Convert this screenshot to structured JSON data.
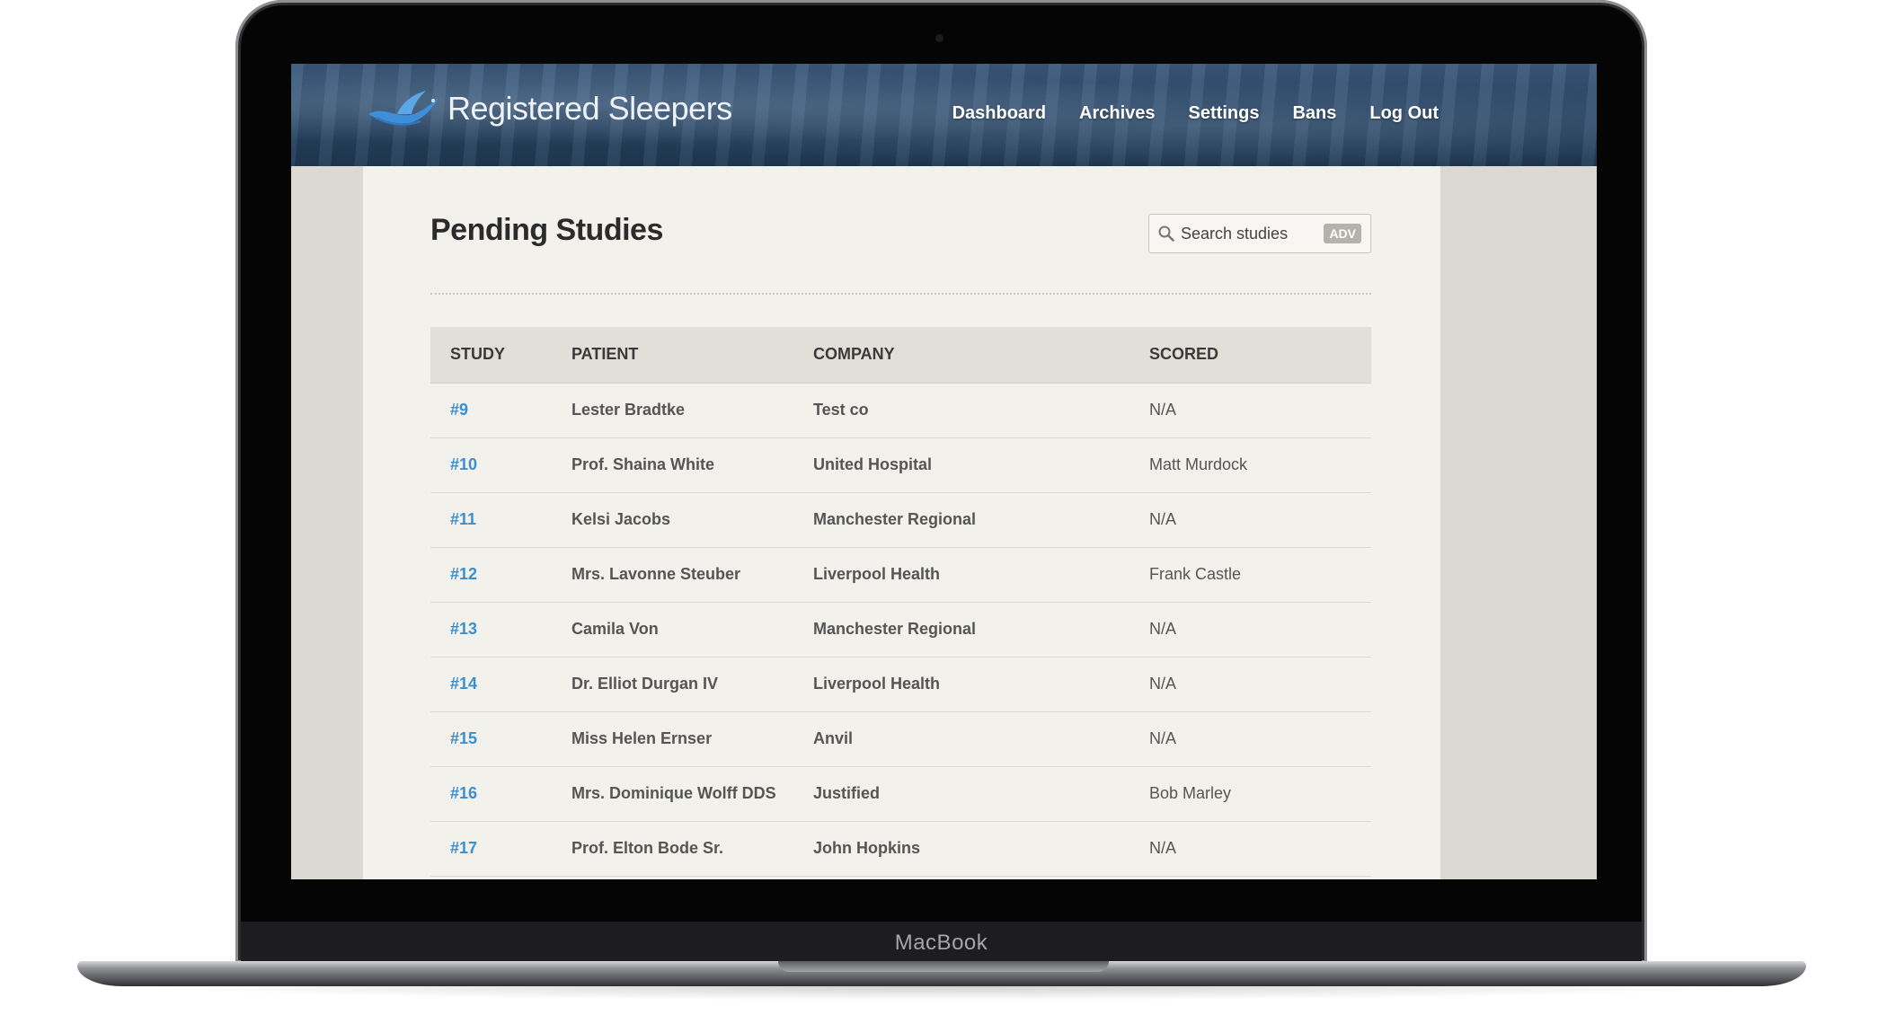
{
  "device": {
    "label": "MacBook"
  },
  "app": {
    "name": "Registered Sleepers",
    "logo_icon": "bird-icon"
  },
  "nav": {
    "items": [
      {
        "label": "Dashboard"
      },
      {
        "label": "Archives"
      },
      {
        "label": "Settings"
      },
      {
        "label": "Bans"
      },
      {
        "label": "Log Out"
      }
    ]
  },
  "page": {
    "title": "Pending Studies"
  },
  "search": {
    "placeholder": "Search studies",
    "adv_label": "ADV",
    "icon": "search-icon"
  },
  "table": {
    "headers": [
      "STUDY",
      "PATIENT",
      "COMPANY",
      "SCORED"
    ],
    "rows": [
      {
        "study": "#9",
        "patient": "Lester Bradtke",
        "company": "Test co",
        "scored": "N/A"
      },
      {
        "study": "#10",
        "patient": "Prof. Shaina White",
        "company": "United Hospital",
        "scored": "Matt Murdock"
      },
      {
        "study": "#11",
        "patient": "Kelsi Jacobs",
        "company": "Manchester Regional",
        "scored": "N/A"
      },
      {
        "study": "#12",
        "patient": "Mrs. Lavonne Steuber",
        "company": "Liverpool Health",
        "scored": "Frank Castle"
      },
      {
        "study": "#13",
        "patient": "Camila Von",
        "company": "Manchester Regional",
        "scored": "N/A"
      },
      {
        "study": "#14",
        "patient": "Dr. Elliot Durgan IV",
        "company": "Liverpool Health",
        "scored": "N/A"
      },
      {
        "study": "#15",
        "patient": "Miss Helen Ernser",
        "company": "Anvil",
        "scored": "N/A"
      },
      {
        "study": "#16",
        "patient": "Mrs. Dominique Wolff DDS",
        "company": "Justified",
        "scored": "Bob Marley"
      },
      {
        "study": "#17",
        "patient": "Prof. Elton Bode Sr.",
        "company": "John Hopkins",
        "scored": "N/A"
      }
    ]
  },
  "colors": {
    "link": "#3a8fd0",
    "header_bg": "#2a4665",
    "content_bg": "#f2f1ec"
  }
}
